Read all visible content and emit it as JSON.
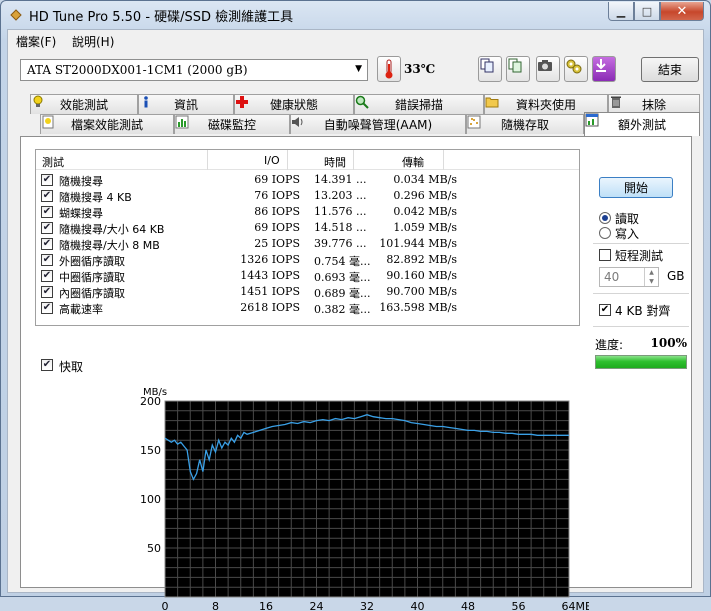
{
  "window": {
    "title": "HD Tune Pro 5.50 - 硬碟/SSD 檢測維護工具"
  },
  "menu": {
    "items": [
      "檔案(F)",
      "說明(H)"
    ]
  },
  "toolbar": {
    "drive": "ATA    ST2000DX001-1CM1 (2000 gB)",
    "temperature": "33℃",
    "exit_label": "結束"
  },
  "tabs": {
    "row1": [
      "效能測試",
      "資訊",
      "健康狀態",
      "錯誤掃描",
      "資料夾使用",
      "抹除"
    ],
    "row2": [
      "檔案效能測試",
      "磁碟監控",
      "自動噪聲管理(AAM)",
      "隨機存取",
      "額外測試"
    ],
    "active": "額外測試"
  },
  "results": {
    "headers": {
      "test": "測試",
      "io": "I/O",
      "time": "時間",
      "transfer": "傳輸"
    },
    "rows": [
      {
        "checked": true,
        "name": "隨機搜尋",
        "io": "69 IOPS",
        "time": "14.391 ...",
        "transfer": "0.034 MB/s"
      },
      {
        "checked": true,
        "name": "隨機搜尋 4 KB",
        "io": "76 IOPS",
        "time": "13.203 ...",
        "transfer": "0.296 MB/s"
      },
      {
        "checked": true,
        "name": "蝴蝶搜尋",
        "io": "86 IOPS",
        "time": "11.576 ...",
        "transfer": "0.042 MB/s"
      },
      {
        "checked": true,
        "name": "隨機搜尋/大小 64 KB",
        "io": "69 IOPS",
        "time": "14.518 ...",
        "transfer": "1.059 MB/s"
      },
      {
        "checked": true,
        "name": "隨機搜尋/大小 8 MB",
        "io": "25 IOPS",
        "time": "39.776 ...",
        "transfer": "101.944 MB/s"
      },
      {
        "checked": true,
        "name": "外圈循序讀取",
        "io": "1326 IOPS",
        "time": "0.754 毫...",
        "transfer": "82.892 MB/s"
      },
      {
        "checked": true,
        "name": "中圈循序讀取",
        "io": "1443 IOPS",
        "time": "0.693 毫...",
        "transfer": "90.160 MB/s"
      },
      {
        "checked": true,
        "name": "內圈循序讀取",
        "io": "1451 IOPS",
        "time": "0.689 毫...",
        "transfer": "90.700 MB/s"
      },
      {
        "checked": true,
        "name": "高載速率",
        "io": "2618 IOPS",
        "time": "0.382 毫...",
        "transfer": "163.598 MB/s"
      }
    ],
    "quick_label": "快取"
  },
  "sidebar": {
    "start_label": "開始",
    "read_label": "讀取",
    "write_label": "寫入",
    "mode": "read",
    "short_test_label": "短程測試",
    "short_test_value": "40",
    "gb_label": "GB",
    "align_label": "4 KB 對齊",
    "progress_label": "進度:",
    "progress_value": "100%",
    "progress_fraction": 1.0
  },
  "colors": {
    "chart_bg": "#000000",
    "grid": "#4a4a4a",
    "line": "#3aa0e6",
    "progress": "#2fc02f"
  },
  "chart_data": {
    "type": "line",
    "ylabel": "MB/s",
    "xlabel": "MB",
    "xlim": [
      0,
      64
    ],
    "ylim": [
      0,
      200
    ],
    "xticks": [
      "0",
      "8",
      "16",
      "24",
      "32",
      "40",
      "48",
      "56",
      "64MB"
    ],
    "yticks": [
      "50",
      "100",
      "150",
      "200"
    ],
    "series": [
      {
        "x": [
          0,
          0.5,
          1,
          1.5,
          2,
          2.5,
          3,
          3.5,
          4,
          4.5,
          5,
          5.5,
          6,
          6.5,
          7,
          7.5,
          8,
          8.5,
          9,
          9.5,
          10,
          10.5,
          11,
          11.5,
          12,
          12.5,
          13,
          14,
          15,
          16,
          17,
          18,
          19,
          20,
          21,
          22,
          23,
          24,
          25,
          26,
          27,
          28,
          29,
          30,
          31,
          32,
          33,
          34,
          35,
          36,
          37,
          38,
          39,
          40,
          41,
          42,
          43,
          44,
          45,
          46,
          47,
          48,
          49,
          50,
          51,
          52,
          53,
          54,
          55,
          56,
          57,
          58,
          59,
          60,
          61,
          62,
          63,
          64
        ],
        "values": [
          162,
          160,
          158,
          160,
          156,
          158,
          154,
          150,
          128,
          120,
          126,
          140,
          128,
          150,
          140,
          155,
          148,
          160,
          152,
          158,
          155,
          162,
          158,
          165,
          162,
          168,
          166,
          168,
          170,
          172,
          174,
          175,
          176,
          178,
          177,
          179,
          178,
          180,
          181,
          180,
          182,
          181,
          183,
          182,
          184,
          186,
          184,
          183,
          182,
          182,
          181,
          180,
          178,
          177,
          176,
          175,
          174,
          174,
          173,
          172,
          171,
          170,
          170,
          169,
          169,
          168,
          168,
          167,
          167,
          166,
          166,
          166,
          165,
          165,
          165,
          165,
          165,
          165
        ]
      }
    ]
  }
}
